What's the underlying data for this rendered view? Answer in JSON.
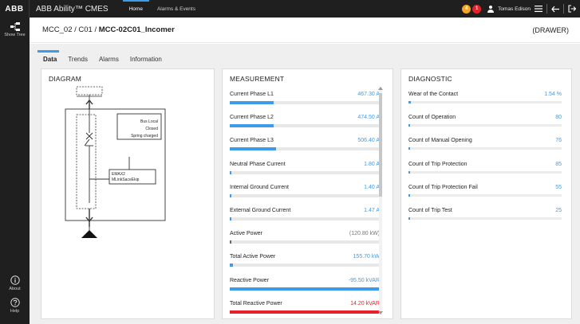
{
  "topbar": {
    "logo": "ABB",
    "app_title": "ABB Ability™ CMES",
    "nav": [
      {
        "label": "Home"
      },
      {
        "label": "Alarms & Events"
      }
    ],
    "badge_orange": "4",
    "badge_red": "1",
    "user": "Tomas Edison"
  },
  "sidebar": {
    "tree_label": "Show Tree",
    "about_label": "About",
    "help_label": "Help"
  },
  "header": {
    "breadcrumb_path": "MCC_02 / C01 / ",
    "breadcrumb_current": "MCC-02C01_Incomer",
    "mode": "(DRAWER)"
  },
  "tabs": [
    {
      "label": "Data"
    },
    {
      "label": "Trends"
    },
    {
      "label": "Alarms"
    },
    {
      "label": "Information"
    }
  ],
  "diagram": {
    "title": "DIAGRAM",
    "status_lines": [
      "Bus Local",
      "Closed",
      "Spring charged"
    ],
    "device_lines": [
      "EMAX2",
      "MLinkSaceEkip"
    ]
  },
  "measurement": {
    "title": "MEASUREMENT",
    "rows": [
      {
        "label": "Current Phase L1",
        "value": "467.30 A",
        "fill": 0.29,
        "color": "blue"
      },
      {
        "label": "Current Phase L2",
        "value": "474.50 A",
        "fill": 0.29,
        "color": "blue"
      },
      {
        "label": "Current Phase L3",
        "value": "506.40 A",
        "fill": 0.31,
        "color": "blue"
      },
      {
        "label": "Neutral Phase Current",
        "value": "1.80 A",
        "fill": 0,
        "color": "blue"
      },
      {
        "label": "Internal Ground Current",
        "value": "1.40 A",
        "fill": 0,
        "color": "blue"
      },
      {
        "label": "External Ground Current",
        "value": "1.47 A",
        "fill": 0,
        "color": "blue"
      },
      {
        "label": "Active Power",
        "value": "(120.80 kW)",
        "fill": 0.01,
        "color": "grey"
      },
      {
        "label": "Total Active Power",
        "value": "155.70 kW",
        "fill": 0.02,
        "color": "blue"
      },
      {
        "label": "Reactive Power",
        "value": "-95.50 kVAR",
        "fill": 1.0,
        "color": "blue"
      },
      {
        "label": "Total Reactive Power",
        "value": "14.20 kVAR",
        "fill": 1.0,
        "color": "red"
      }
    ]
  },
  "diagnostic": {
    "title": "DIAGNOSTIC",
    "rows": [
      {
        "label": "Wear of the Contact",
        "value": "1.54 %",
        "fill": 0.015
      },
      {
        "label": "Count of Operation",
        "value": "80",
        "fill": 0.01
      },
      {
        "label": "Count of Manual Opening",
        "value": "76",
        "fill": 0.01
      },
      {
        "label": "Count of Trip Protection",
        "value": "85",
        "fill": 0.01
      },
      {
        "label": "Count of Trip Protection Fail",
        "value": "55",
        "fill": 0.005
      },
      {
        "label": "Count of Trip Test",
        "value": "25",
        "fill": 0.005
      }
    ]
  }
}
